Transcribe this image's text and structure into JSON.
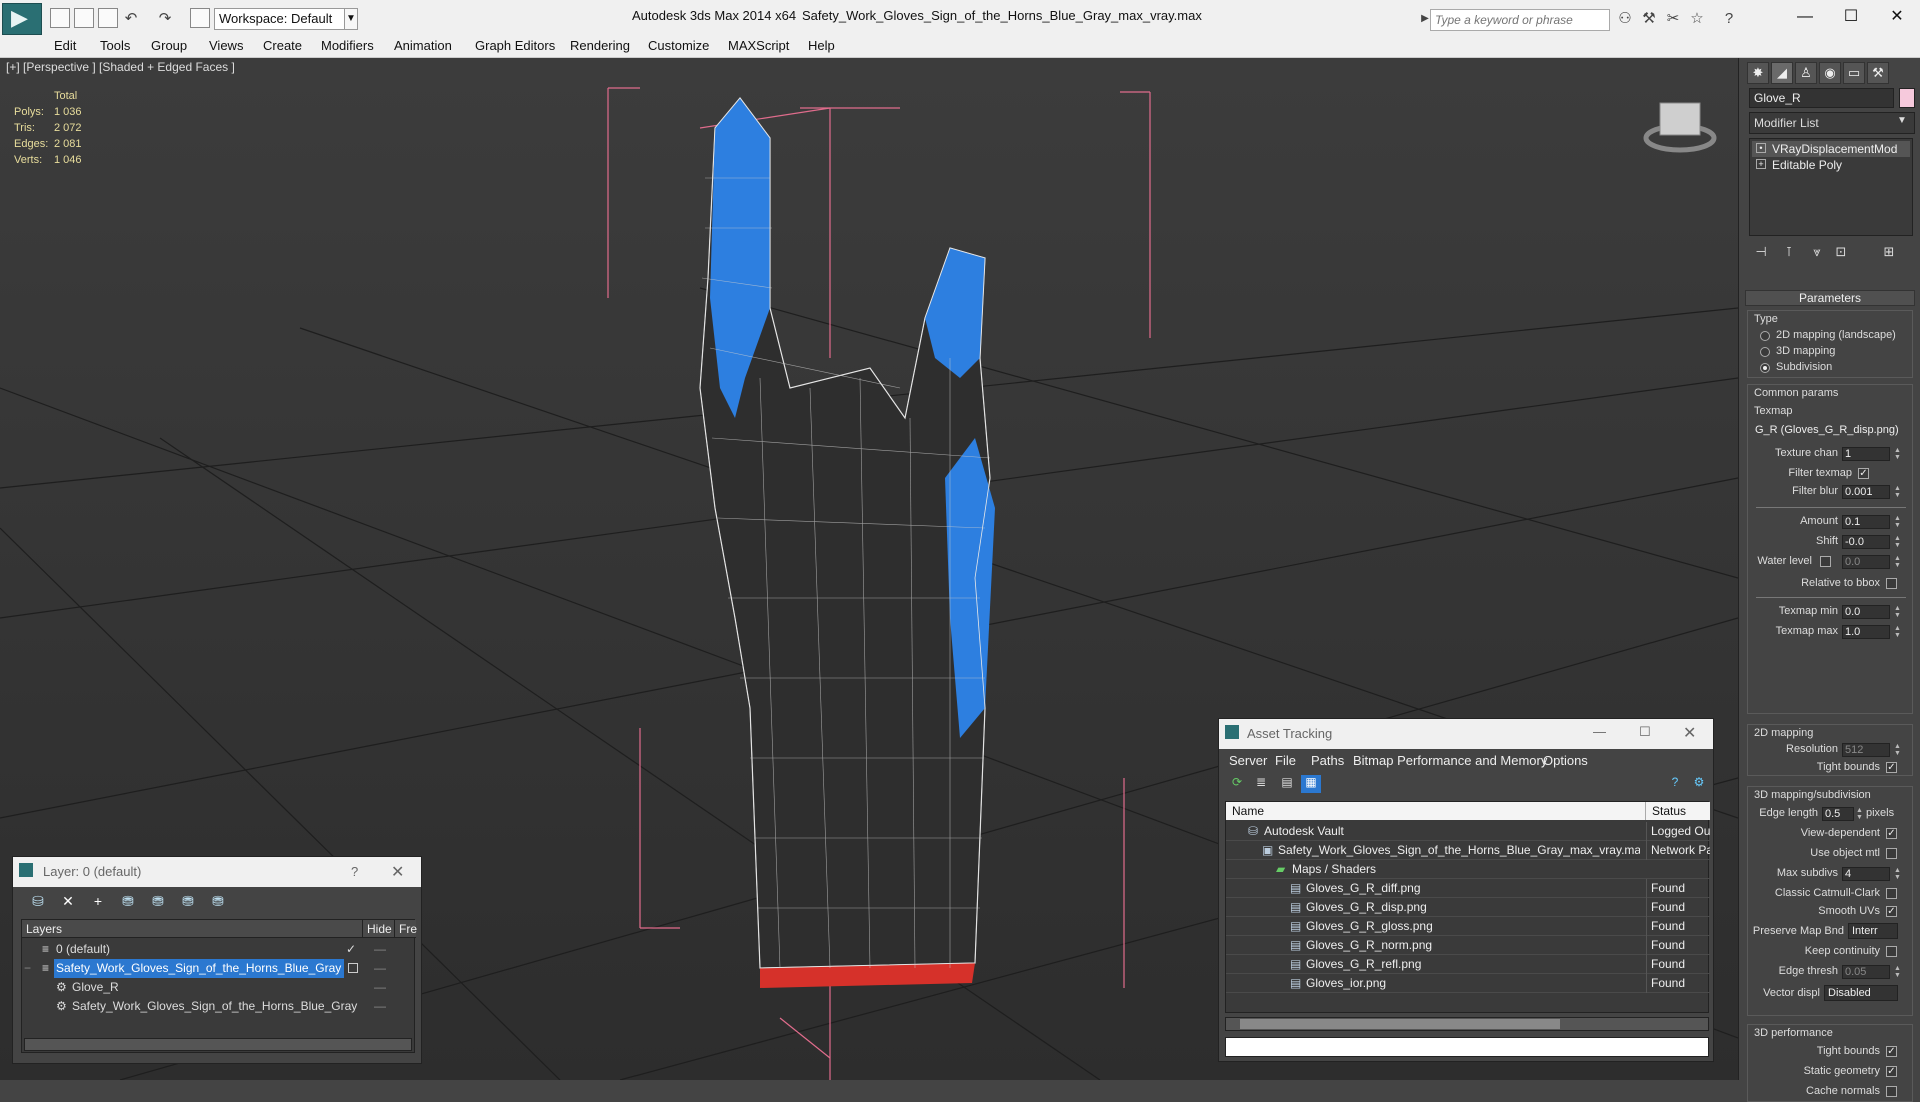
{
  "title": {
    "app": "Autodesk 3ds Max  2014 x64",
    "file": "Safety_Work_Gloves_Sign_of_the_Horns_Blue_Gray_max_vray.max",
    "workspace": "Workspace: Default",
    "search_placeholder": "Type a keyword or phrase"
  },
  "menu": [
    "Edit",
    "Tools",
    "Group",
    "Views",
    "Create",
    "Modifiers",
    "Animation",
    "Graph Editors",
    "Rendering",
    "Customize",
    "MAXScript",
    "Help"
  ],
  "viewport": {
    "label": "[+] [Perspective ] [Shaded + Edged Faces ]",
    "stats": {
      "header": "Total",
      "polys_label": "Polys:",
      "polys": "1 036",
      "tris_label": "Tris:",
      "tris": "2 072",
      "edges_label": "Edges:",
      "edges": "2 081",
      "verts_label": "Verts:",
      "verts": "1 046"
    }
  },
  "command_panel": {
    "object_name": "Glove_R",
    "object_color": "#f6c9dc",
    "modifier_list": "Modifier List",
    "stack": [
      "VRayDisplacementMod",
      "Editable Poly"
    ],
    "rollout": "Parameters",
    "type_label": "Type",
    "type_options": [
      "2D mapping (landscape)",
      "3D mapping",
      "Subdivision"
    ],
    "type_selected": "Subdivision",
    "common_label": "Common params",
    "texmap_label": "Texmap",
    "texmap_value": "G_R (Gloves_G_R_disp.png)",
    "texture_chan_label": "Texture chan",
    "texture_chan": "1",
    "filter_texmap_label": "Filter texmap",
    "filter_blur_label": "Filter blur",
    "filter_blur": "0.001",
    "amount_label": "Amount",
    "amount": "0.1",
    "shift_label": "Shift",
    "shift": "-0.0",
    "water_label": "Water level",
    "water": "0.0",
    "relative_label": "Relative to bbox",
    "texmin_label": "Texmap min",
    "texmin": "0.0",
    "texmax_label": "Texmap max",
    "texmax": "1.0",
    "map2d_label": "2D mapping",
    "resolution_label": "Resolution",
    "resolution": "512",
    "tight_bounds_label": "Tight bounds",
    "map3d_label": "3D mapping/subdivision",
    "edge_length_label": "Edge length",
    "edge_length": "0.5",
    "edge_unit": "pixels",
    "view_dep_label": "View-dependent",
    "use_obj_mtl_label": "Use object mtl",
    "max_subdivs_label": "Max subdivs",
    "max_subdivs": "4",
    "catmull_label": "Classic Catmull-Clark",
    "smooth_uvs_label": "Smooth UVs",
    "preserve_label": "Preserve Map Bnd",
    "preserve": "Interr",
    "keep_cont_label": "Keep continuity",
    "edge_thresh_label": "Edge thresh",
    "edge_thresh": "0.05",
    "vector_label": "Vector displ",
    "vector": "Disabled",
    "perf_label": "3D performance",
    "perf_tight_label": "Tight bounds",
    "static_geo_label": "Static geometry",
    "cache_normals_label": "Cache normals"
  },
  "layer_window": {
    "title": "Layer: 0 (default)",
    "help": "?",
    "col_layers": "Layers",
    "col_hide": "Hide",
    "col_freeze": "Fre",
    "rows": [
      {
        "name": "0 (default)",
        "indent": 1
      },
      {
        "name": "Safety_Work_Gloves_Sign_of_the_Horns_Blue_Gray",
        "indent": 1
      },
      {
        "name": "Glove_R",
        "indent": 2
      },
      {
        "name": "Safety_Work_Gloves_Sign_of_the_Horns_Blue_Gray",
        "indent": 2
      }
    ]
  },
  "asset_window": {
    "title": "Asset Tracking",
    "menu": [
      "Server",
      "File",
      "Paths",
      "Bitmap Performance and Memory",
      "Options"
    ],
    "col_name": "Name",
    "col_status": "Status",
    "rows": [
      {
        "name": "Autodesk Vault",
        "status": "Logged Ou",
        "indent": 1
      },
      {
        "name": "Safety_Work_Gloves_Sign_of_the_Horns_Blue_Gray_max_vray.max",
        "status": "Network Pa",
        "indent": 2
      },
      {
        "name": "Maps / Shaders",
        "status": "",
        "indent": 3
      },
      {
        "name": "Gloves_G_R_diff.png",
        "status": "Found",
        "indent": 4
      },
      {
        "name": "Gloves_G_R_disp.png",
        "status": "Found",
        "indent": 4
      },
      {
        "name": "Gloves_G_R_gloss.png",
        "status": "Found",
        "indent": 4
      },
      {
        "name": "Gloves_G_R_norm.png",
        "status": "Found",
        "indent": 4
      },
      {
        "name": "Gloves_G_R_refl.png",
        "status": "Found",
        "indent": 4
      },
      {
        "name": "Gloves_ior.png",
        "status": "Found",
        "indent": 4
      }
    ]
  }
}
